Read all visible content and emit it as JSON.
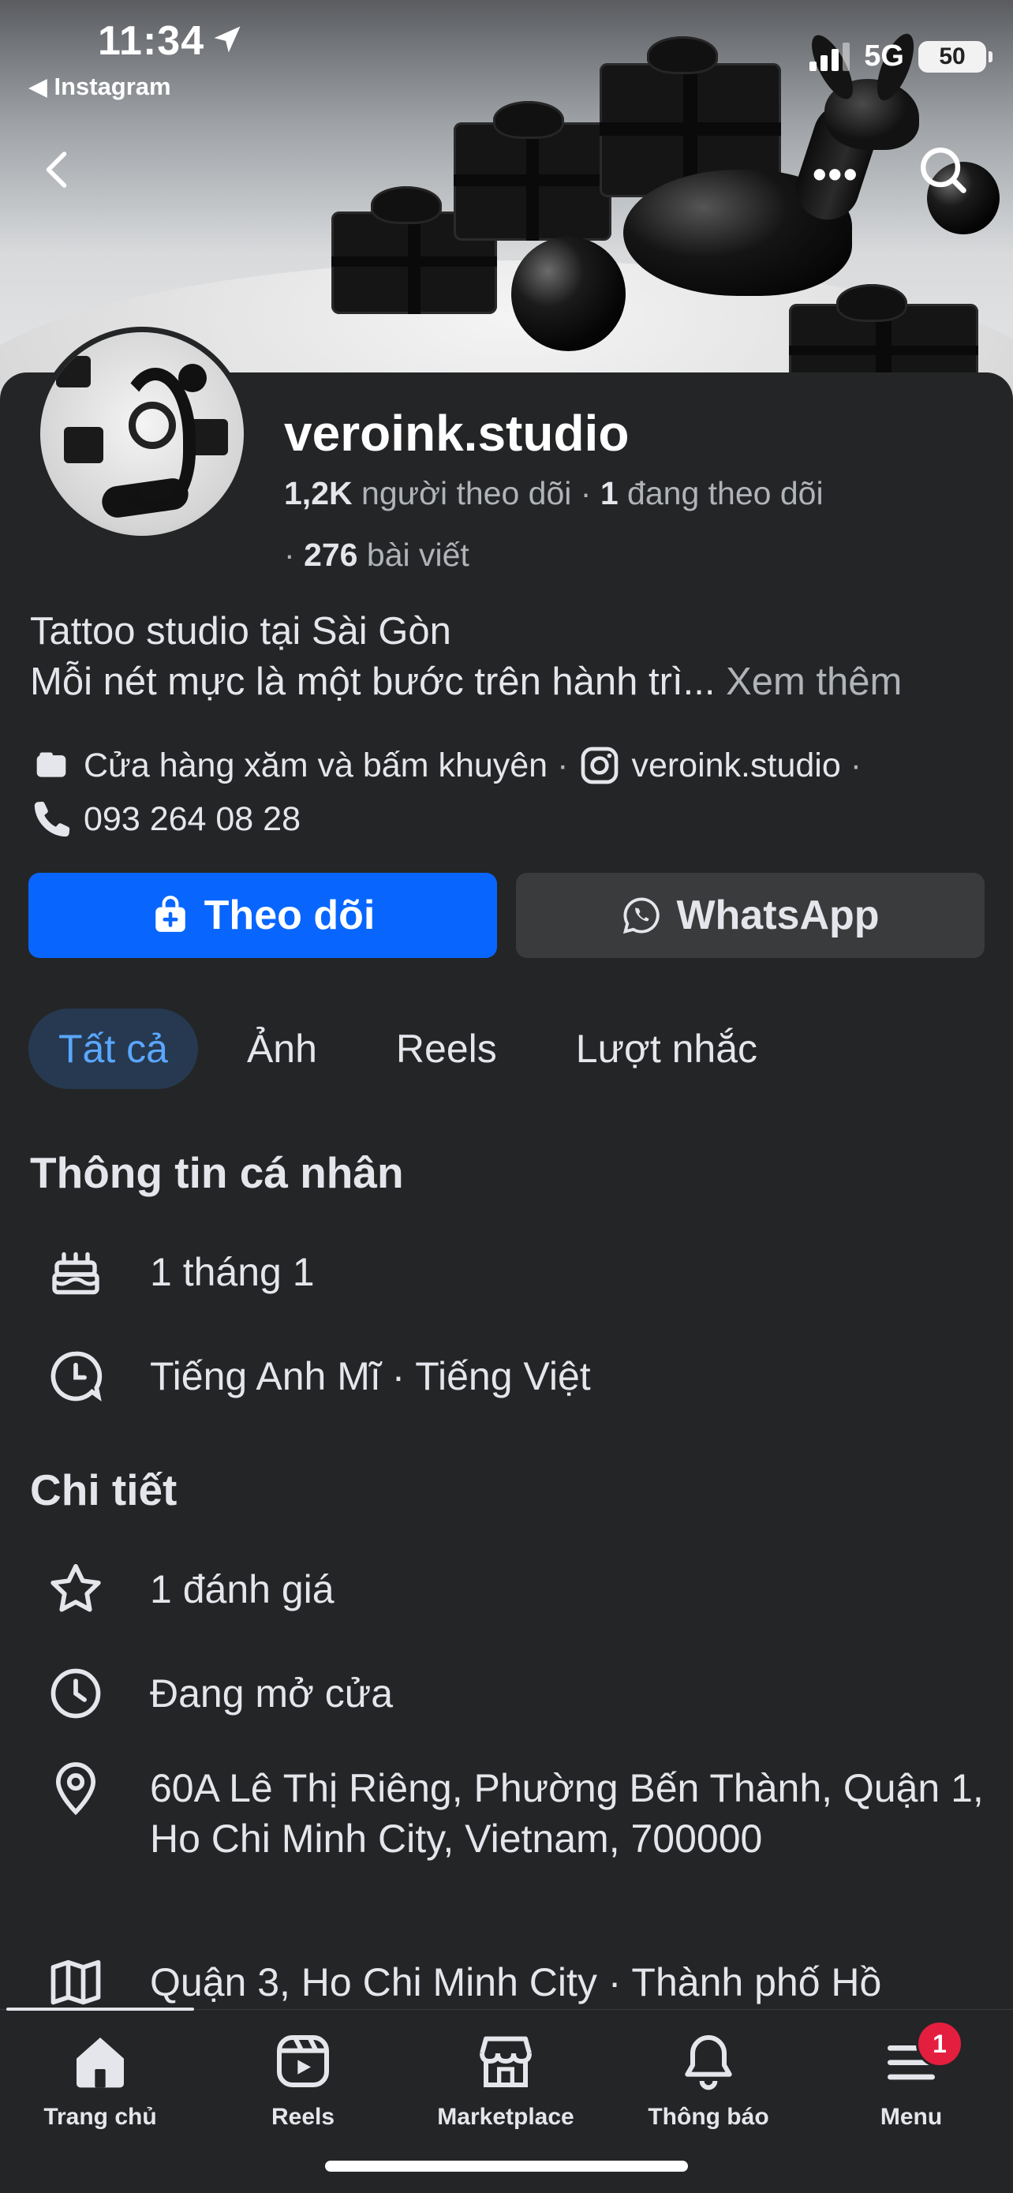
{
  "status_bar": {
    "time": "11:34",
    "back_app": "◀ Instagram",
    "network": "5G",
    "battery": "50"
  },
  "profile": {
    "name": "veroink.studio",
    "followers_count": "1,2K",
    "followers_label": "người theo dõi",
    "following_count": "1",
    "following_label": "đang theo dõi",
    "posts_count": "276",
    "posts_label": "bài viết",
    "bio_line1": "Tattoo studio tại Sài Gòn",
    "bio_line2": "Mỗi nét mực là một bước trên hành trì...",
    "see_more": "Xem thêm",
    "category": "Cửa hàng xăm và bấm khuyên",
    "instagram": "veroink.studio",
    "phone": "093 264 08 28"
  },
  "actions": {
    "follow_label": "Theo dõi",
    "whatsapp_label": "WhatsApp"
  },
  "tabs": [
    {
      "label": "Tất cả",
      "active": true
    },
    {
      "label": "Ảnh",
      "active": false
    },
    {
      "label": "Reels",
      "active": false
    },
    {
      "label": "Lượt nhắc",
      "active": false
    }
  ],
  "personal_info": {
    "title": "Thông tin cá nhân",
    "birthday": "1 tháng 1",
    "languages": "Tiếng Anh Mĩ · Tiếng Việt"
  },
  "details": {
    "title": "Chi tiết",
    "rating": "1 đánh giá",
    "hours": "Đang mở cửa",
    "address": "60A Lê Thị Riêng, Phường Bến Thành, Quận 1, Ho Chi Minh City, Vietnam, 700000",
    "area": "Quận 3, Ho Chi Minh City · Thành phố Hồ"
  },
  "bottom_nav": [
    {
      "label": "Trang chủ",
      "icon": "home-icon"
    },
    {
      "label": "Reels",
      "icon": "reels-icon"
    },
    {
      "label": "Marketplace",
      "icon": "marketplace-icon"
    },
    {
      "label": "Thông báo",
      "icon": "bell-icon"
    },
    {
      "label": "Menu",
      "icon": "menu-icon",
      "badge": "1"
    }
  ],
  "colors": {
    "background": "#242526",
    "primary_button": "#0866ff",
    "secondary_button": "#3a3b3c",
    "active_tab_bg": "#263951",
    "active_tab_text": "#5aa7ff",
    "badge": "#e41e3f"
  }
}
